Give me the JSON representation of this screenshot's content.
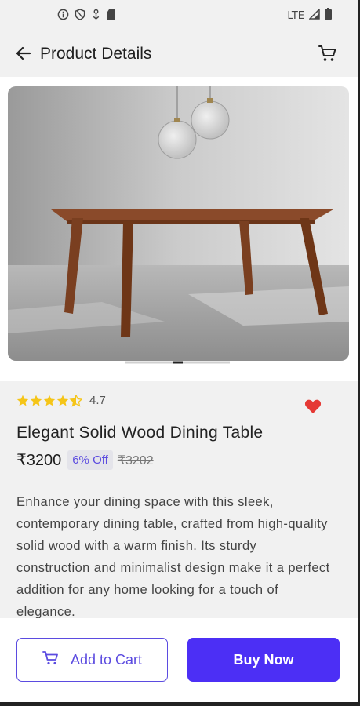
{
  "status_bar": {
    "network": "LTE",
    "icons_left": [
      "info-icon",
      "shield-icon",
      "download-icon",
      "sd-card-icon"
    ],
    "icons_right": [
      "signal-icon",
      "battery-icon"
    ]
  },
  "app_bar": {
    "title": "Product Details",
    "back_icon": "arrow-left-icon",
    "cart_icon": "cart-icon"
  },
  "gallery": {
    "image_alt": "Wooden dining table with pendant lights",
    "page_count": 3,
    "active_page": 2
  },
  "product": {
    "rating": "4.7",
    "rating_stars": 4.5,
    "name": "Elegant Solid Wood Dining Table",
    "price": "₹3200",
    "discount": "6% Off",
    "original_price": "₹3202",
    "favorited": true,
    "description": "Enhance your dining space with this sleek, contemporary dining table, crafted from high-quality solid wood with a warm finish. Its sturdy construction and minimalist design make it a perfect addition for any home looking for a touch of elegance."
  },
  "actions": {
    "add_to_cart": "Add to Cart",
    "buy_now": "Buy Now"
  },
  "colors": {
    "accent": "#4c2ff5",
    "star": "#f5c518",
    "heart": "#e53935"
  }
}
